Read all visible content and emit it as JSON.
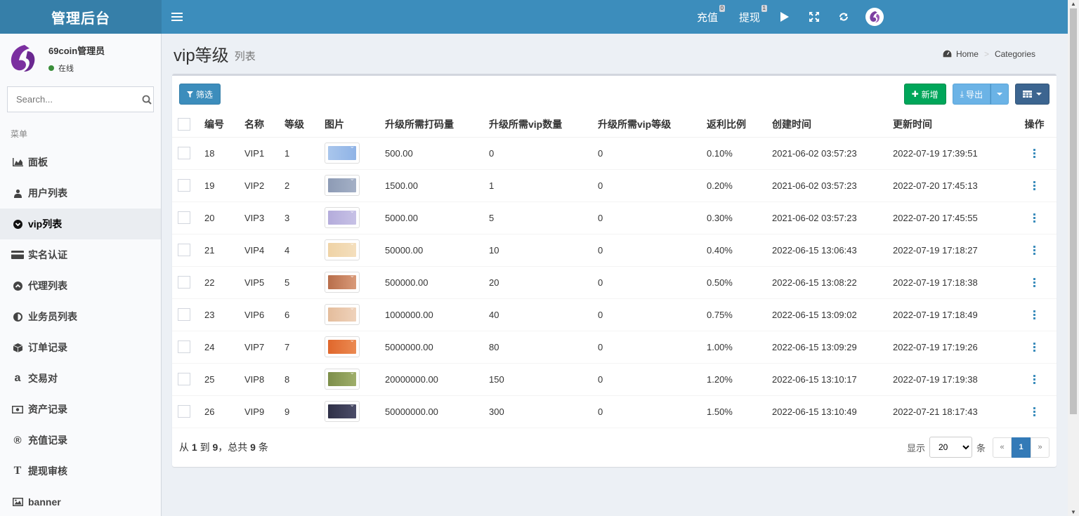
{
  "app": {
    "title": "管理后台"
  },
  "topbar": {
    "recharge": {
      "label": "充值",
      "badge": "0"
    },
    "withdraw": {
      "label": "提现",
      "badge": "1"
    },
    "icons": [
      "play-icon",
      "fullscreen-icon",
      "refresh-icon",
      "avatar-logo"
    ]
  },
  "user": {
    "name": "69coin管理员",
    "status": "在线"
  },
  "search": {
    "placeholder": "Search..."
  },
  "menu": {
    "header": "菜单",
    "items": [
      {
        "label": "面板",
        "icon": "area-chart-icon"
      },
      {
        "label": "用户列表",
        "icon": "users-icon"
      },
      {
        "label": "vip列表",
        "icon": "chevron-circle-down-icon",
        "active": true
      },
      {
        "label": "实名认证",
        "icon": "credit-card-icon"
      },
      {
        "label": "代理列表",
        "icon": "chevron-circle-up-icon"
      },
      {
        "label": "业务员列表",
        "icon": "adjust-icon"
      },
      {
        "label": "订单记录",
        "icon": "cube-icon"
      },
      {
        "label": "交易对",
        "icon": "amazon-icon"
      },
      {
        "label": "资产记录",
        "icon": "money-icon"
      },
      {
        "label": "充值记录",
        "icon": "registered-icon"
      },
      {
        "label": "提现审核",
        "icon": "text-height-icon"
      },
      {
        "label": "banner",
        "icon": "image-icon"
      }
    ]
  },
  "page": {
    "title": "vip等级",
    "subtitle": "列表"
  },
  "breadcrumb": {
    "home": "Home",
    "current": "Categories"
  },
  "toolbar": {
    "filter": "筛选",
    "add": "新增",
    "export": "导出"
  },
  "table": {
    "columns": [
      "编号",
      "名称",
      "等级",
      "图片",
      "升级所需打码量",
      "升级所需vip数量",
      "升级所需vip等级",
      "返利比例",
      "创建时间",
      "更新时间",
      "操作"
    ],
    "rows": [
      {
        "id": "18",
        "name": "VIP1",
        "level": "1",
        "thumb": [
          "#a9c6ec",
          "#8fb3e6"
        ],
        "bet": "500.00",
        "vip_count": "0",
        "vip_level": "0",
        "rebate": "0.10%",
        "created": "2021-06-02 03:57:23",
        "updated": "2022-07-19 17:39:51"
      },
      {
        "id": "19",
        "name": "VIP2",
        "level": "2",
        "thumb": [
          "#8d9bb5",
          "#a4b0c6"
        ],
        "bet": "1500.00",
        "vip_count": "1",
        "vip_level": "0",
        "rebate": "0.20%",
        "created": "2021-06-02 03:57:23",
        "updated": "2022-07-20 17:45:13"
      },
      {
        "id": "20",
        "name": "VIP3",
        "level": "3",
        "thumb": [
          "#b4acdb",
          "#c7c1e6"
        ],
        "bet": "5000.00",
        "vip_count": "5",
        "vip_level": "0",
        "rebate": "0.30%",
        "created": "2021-06-02 03:57:23",
        "updated": "2022-07-20 17:45:55"
      },
      {
        "id": "21",
        "name": "VIP4",
        "level": "4",
        "thumb": [
          "#efd3a6",
          "#f4dfbd"
        ],
        "bet": "50000.00",
        "vip_count": "10",
        "vip_level": "0",
        "rebate": "0.40%",
        "created": "2022-06-15 13:06:43",
        "updated": "2022-07-19 17:18:27"
      },
      {
        "id": "22",
        "name": "VIP5",
        "level": "5",
        "thumb": [
          "#b86e4b",
          "#d99a79"
        ],
        "bet": "500000.00",
        "vip_count": "20",
        "vip_level": "0",
        "rebate": "0.50%",
        "created": "2022-06-15 13:08:22",
        "updated": "2022-07-19 17:18:38"
      },
      {
        "id": "23",
        "name": "VIP6",
        "level": "6",
        "thumb": [
          "#e4bd9c",
          "#efd2bb"
        ],
        "bet": "1000000.00",
        "vip_count": "40",
        "vip_level": "0",
        "rebate": "0.75%",
        "created": "2022-06-15 13:09:02",
        "updated": "2022-07-19 17:18:49"
      },
      {
        "id": "24",
        "name": "VIP7",
        "level": "7",
        "thumb": [
          "#e0672c",
          "#eb8a52"
        ],
        "bet": "5000000.00",
        "vip_count": "80",
        "vip_level": "0",
        "rebate": "1.00%",
        "created": "2022-06-15 13:09:29",
        "updated": "2022-07-19 17:19:26"
      },
      {
        "id": "25",
        "name": "VIP8",
        "level": "8",
        "thumb": [
          "#7d8f4a",
          "#9fae6a"
        ],
        "bet": "20000000.00",
        "vip_count": "150",
        "vip_level": "0",
        "rebate": "1.20%",
        "created": "2022-06-15 13:10:17",
        "updated": "2022-07-19 17:19:38"
      },
      {
        "id": "26",
        "name": "VIP9",
        "level": "9",
        "thumb": [
          "#2f3047",
          "#4b4d69"
        ],
        "bet": "50000000.00",
        "vip_count": "300",
        "vip_level": "0",
        "rebate": "1.50%",
        "created": "2022-06-15 13:10:49",
        "updated": "2022-07-21 18:17:43"
      }
    ]
  },
  "summary": {
    "prefix": "从",
    "from": "1",
    "to_word": "到",
    "to": "9",
    "total_word": "，总共",
    "total": "9",
    "suffix": "条"
  },
  "pagination": {
    "show_label": "显示",
    "per_page": "20",
    "unit": "条",
    "prev": "«",
    "current": "1",
    "next": "»"
  },
  "colors": {
    "primary": "#3c8dbc",
    "success": "#00a65a",
    "sidebar_bg": "#f9fafc",
    "content_bg": "#ecf0f5"
  }
}
